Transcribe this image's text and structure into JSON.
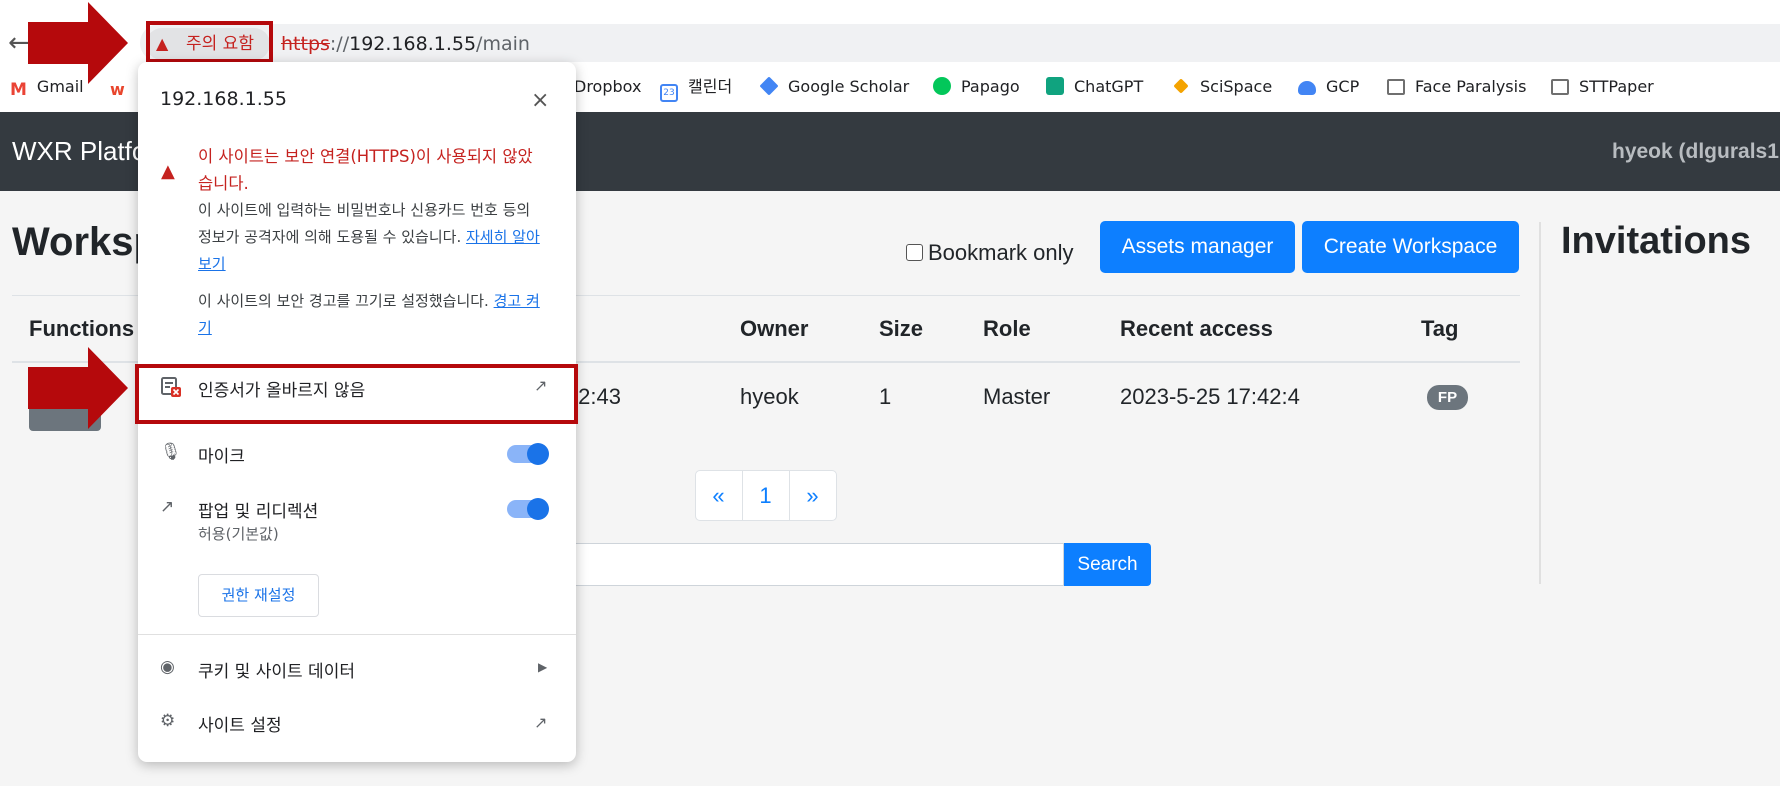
{
  "browser": {
    "security_chip": "주의 요함",
    "url_scheme": "https",
    "url_sep": "://",
    "url_host": "192.168.1.55",
    "url_path": "/main",
    "bookmarks": [
      {
        "label": "Gmail",
        "color": "#ea4335"
      },
      {
        "label": "",
        "color": "#e8452c"
      },
      {
        "label": "Dropbox",
        "color": "#0061ff"
      },
      {
        "label": "캘린더",
        "color": "#4285f4"
      },
      {
        "label": "Google Scholar",
        "color": "#4285f4"
      },
      {
        "label": "Papago",
        "color": "#03c75a"
      },
      {
        "label": "ChatGPT",
        "color": "#10a37f"
      },
      {
        "label": "SciSpace",
        "color": "#f4a300"
      },
      {
        "label": "GCP",
        "color": "#4285f4"
      },
      {
        "label": "Face Paralysis",
        "color": "#6f6f6f"
      },
      {
        "label": "STTPaper",
        "color": "#6f6f6f"
      }
    ]
  },
  "app": {
    "brand": "WXR Platfo",
    "user": "hyeok (dlgurals1",
    "page_title": "Worksp",
    "invitations_title": "Invitations",
    "bookmark_only_label": "Bookmark only",
    "assets_button": "Assets manager",
    "create_button": "Create Workspace",
    "table": {
      "headers": [
        "Functions",
        "Owner",
        "Size",
        "Role",
        "Recent access",
        "Tag"
      ],
      "row": {
        "created_partial": ":2:43",
        "owner": "hyeok",
        "size": "1",
        "role": "Master",
        "recent_access": "2023-5-25 17:42:4",
        "tag": "FP"
      }
    },
    "pagination": {
      "prev": "«",
      "page": "1",
      "next": "»"
    },
    "search_button": "Search"
  },
  "popup": {
    "host": "192.168.1.55",
    "close": "×",
    "warning_title_line1": "이 사이트는 보안 연결(HTTPS)이 사용되지 않았",
    "warning_title_line2": "습니다.",
    "warning_body_line1": "이 사이트에 입력하는 비밀번호나 신용카드 번호 등의",
    "warning_body_line2": "정보가 공격자에 의해 도용될 수 있습니다. ",
    "warning_body_link_a": "자세히 알아",
    "warning_body_link_b": "보기",
    "warning_off_text": "이 사이트의 보안 경고를 끄기로 설정했습니다. ",
    "warning_off_link_a": "경고 켜",
    "warning_off_link_b": "기",
    "cert_label": "인증서가 올바르지 않음",
    "mic_label": "마이크",
    "popup_label": "팝업 및 리디렉션",
    "popup_sub": "허용(기본값)",
    "reset_button": "권한 재설정",
    "cookies_label": "쿠키 및 사이트 데이터",
    "site_settings_label": "사이트 설정",
    "toggles": {
      "mic": true,
      "popups": true
    }
  },
  "colors": {
    "accent": "#0d7fff",
    "navbar": "#343a40",
    "warning_red": "#c5221f",
    "annotation_red": "#b5090c"
  }
}
